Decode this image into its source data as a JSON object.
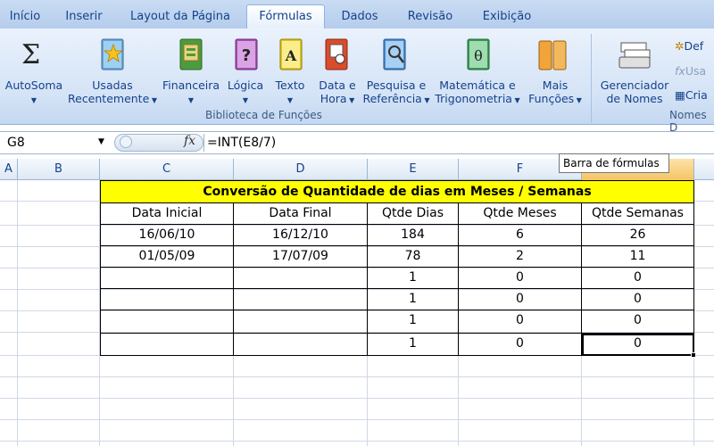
{
  "tabs": [
    "Início",
    "Inserir",
    "Layout da Página",
    "Fórmulas",
    "Dados",
    "Revisão",
    "Exibição"
  ],
  "ribbon": {
    "autosum": "AutoSoma",
    "used_1": "Usadas",
    "used_2": "Recentemente",
    "financial": "Financeira",
    "logical": "Lógica",
    "text": "Texto",
    "date_1": "Data e",
    "date_2": "Hora",
    "lookup_1": "Pesquisa e",
    "lookup_2": "Referência",
    "math_1": "Matemática e",
    "math_2": "Trigonometria",
    "more_1": "Mais",
    "more_2": "Funções",
    "library_label": "Biblioteca de Funções",
    "name_mgr_1": "Gerenciador",
    "name_mgr_2": "de Nomes",
    "define": "Def",
    "use": "Usa",
    "create": "Cria",
    "names_label": "Nomes D"
  },
  "formula_bar": {
    "name_box": "G8",
    "fx": "fx",
    "formula": "=INT(E8/7)",
    "tooltip": "Barra de fórmulas"
  },
  "columns": [
    "A",
    "B",
    "C",
    "D",
    "E",
    "F"
  ],
  "sheet": {
    "title": "Conversão de Quantidade de dias em Meses / Semanas",
    "headers": [
      "Data Inicial",
      "Data Final",
      "Qtde Dias",
      "Qtde Meses",
      "Qtde Semanas"
    ],
    "rows": [
      [
        "16/06/10",
        "16/12/10",
        "184",
        "6",
        "26"
      ],
      [
        "01/05/09",
        "17/07/09",
        "78",
        "2",
        "11"
      ],
      [
        "",
        "",
        "1",
        "0",
        "0"
      ],
      [
        "",
        "",
        "1",
        "0",
        "0"
      ],
      [
        "",
        "",
        "1",
        "0",
        "0"
      ],
      [
        "",
        "",
        "1",
        "0",
        "0"
      ]
    ]
  },
  "colors": {
    "title_fill": "#ffff00",
    "ribbon_text": "#15428b"
  }
}
